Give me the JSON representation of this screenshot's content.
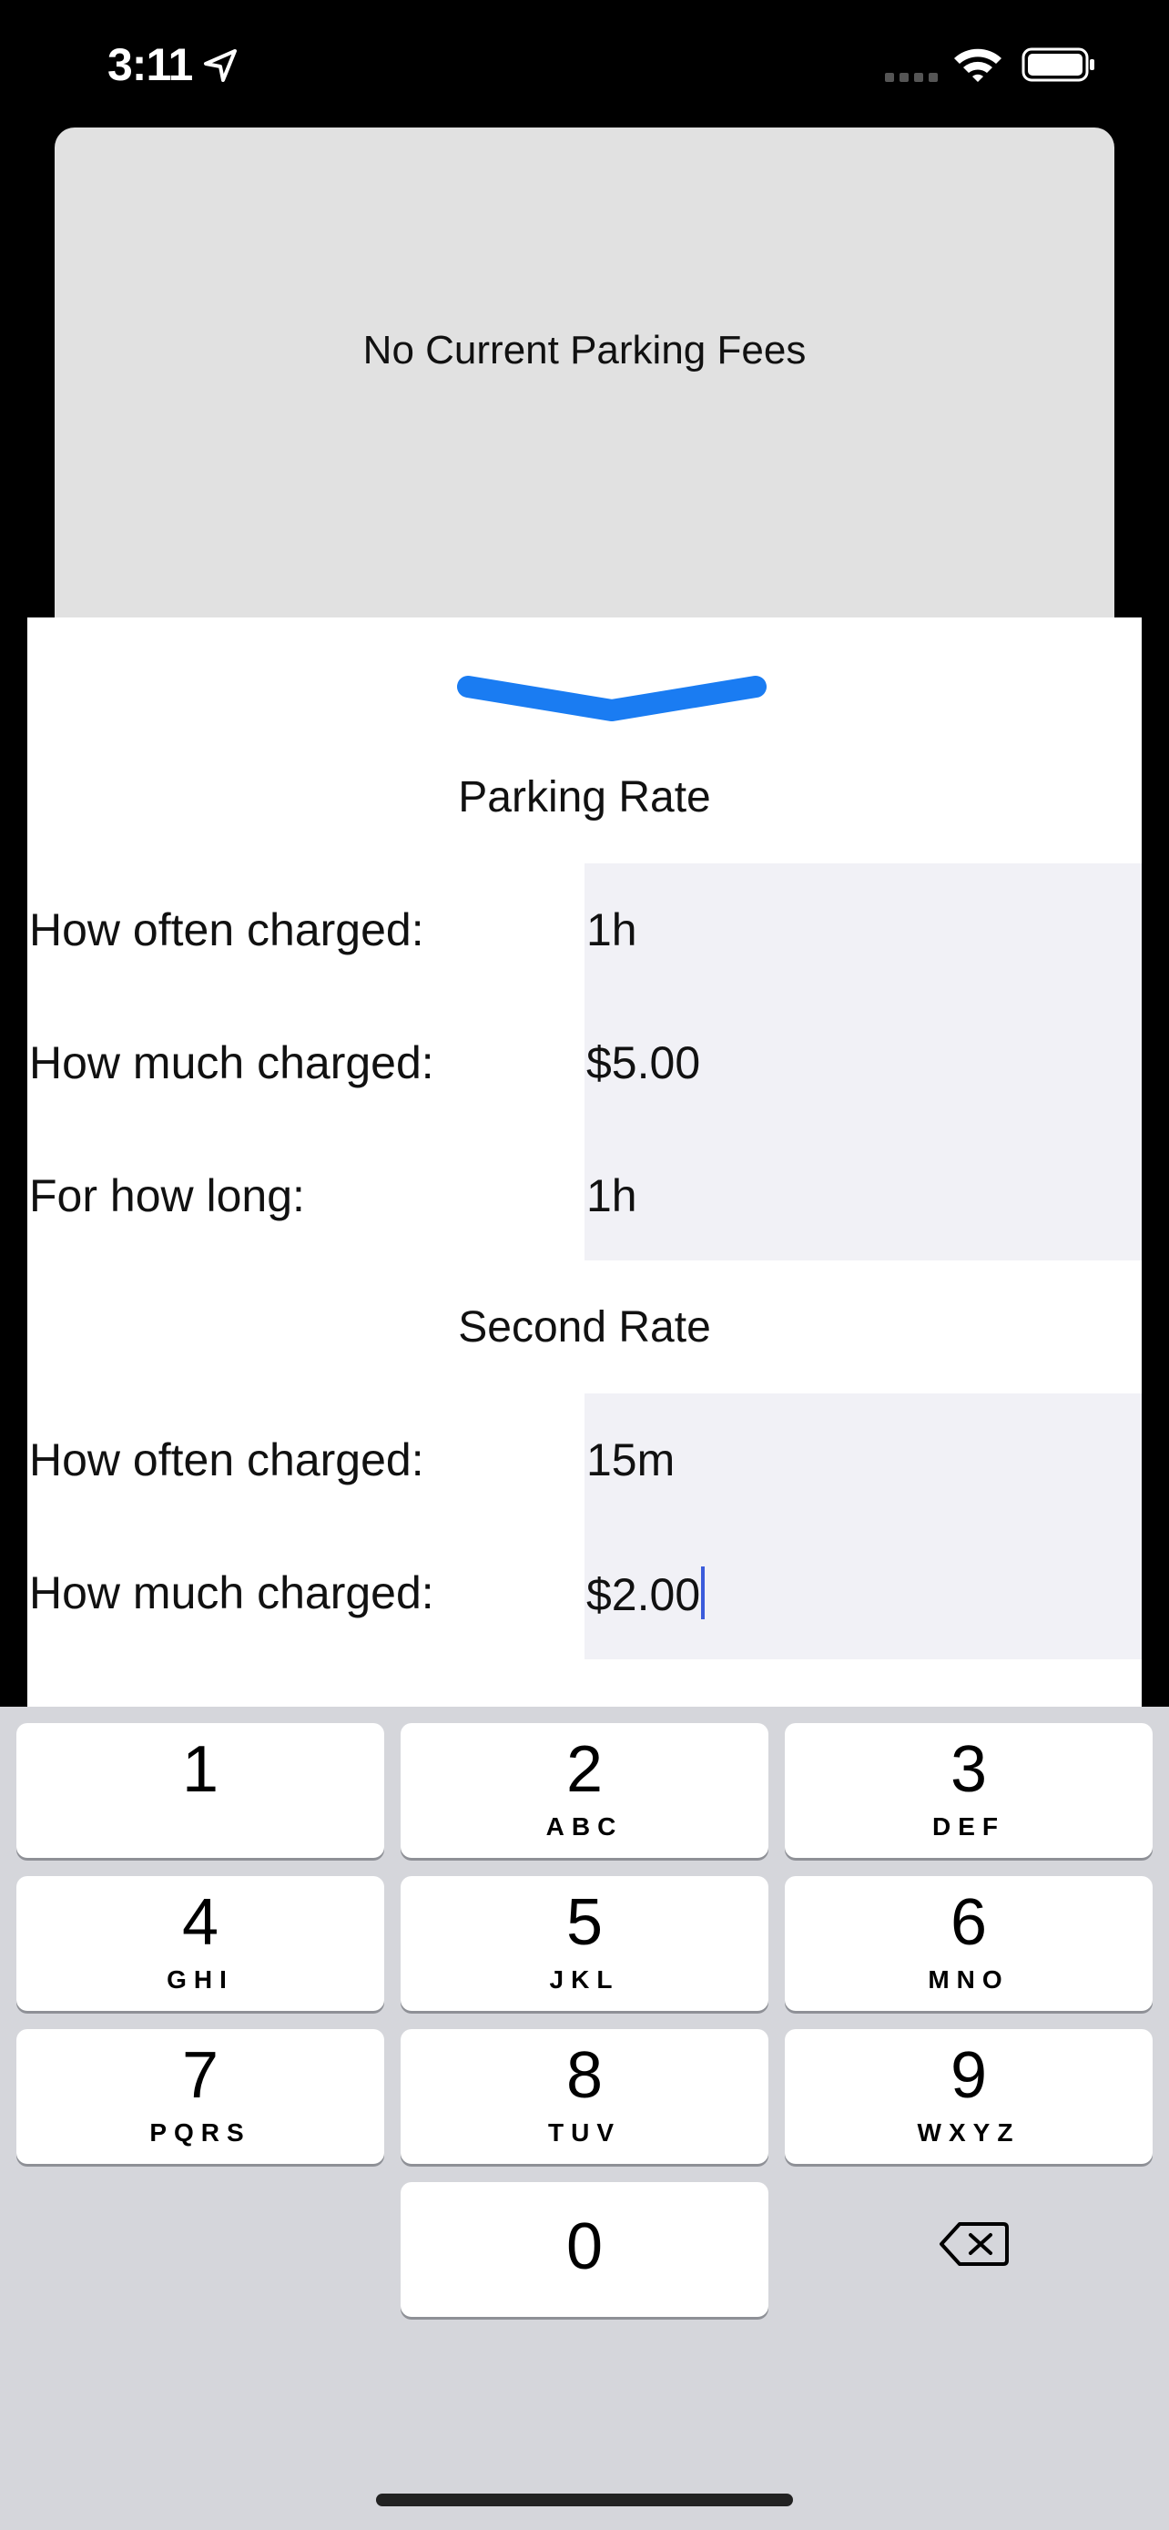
{
  "status_bar": {
    "time": "3:11",
    "icons": [
      "location-arrow-icon",
      "cellular-signal-icon",
      "wifi-icon",
      "battery-icon"
    ]
  },
  "fee_card": {
    "text": "No Current Parking Fees"
  },
  "sheet": {
    "handle_icon": "chevron-down-icon",
    "parking_rate": {
      "title": "Parking Rate",
      "rows": [
        {
          "label": "How often charged:",
          "value": "1h"
        },
        {
          "label": "How much charged:",
          "value": "$5.00"
        },
        {
          "label": "For how long:",
          "value": "1h"
        }
      ]
    },
    "second_rate": {
      "title": "Second Rate",
      "rows": [
        {
          "label": "How often charged:",
          "value": "15m"
        },
        {
          "label": "How much charged:",
          "value": "$2.00"
        }
      ]
    }
  },
  "keyboard": {
    "keys": [
      {
        "digit": "1",
        "letters": ""
      },
      {
        "digit": "2",
        "letters": "ABC"
      },
      {
        "digit": "3",
        "letters": "DEF"
      },
      {
        "digit": "4",
        "letters": "GHI"
      },
      {
        "digit": "5",
        "letters": "JKL"
      },
      {
        "digit": "6",
        "letters": "MNO"
      },
      {
        "digit": "7",
        "letters": "PQRS"
      },
      {
        "digit": "8",
        "letters": "TUV"
      },
      {
        "digit": "9",
        "letters": "WXYZ"
      },
      {
        "digit": "0",
        "letters": ""
      }
    ],
    "delete_icon": "backspace-icon"
  },
  "colors": {
    "accent": "#1a7cf2",
    "field_background": "#f1f1f6",
    "card_background": "#e1e1e1",
    "keyboard_background": "#d5d6db",
    "cursor": "#3b5bdb"
  }
}
